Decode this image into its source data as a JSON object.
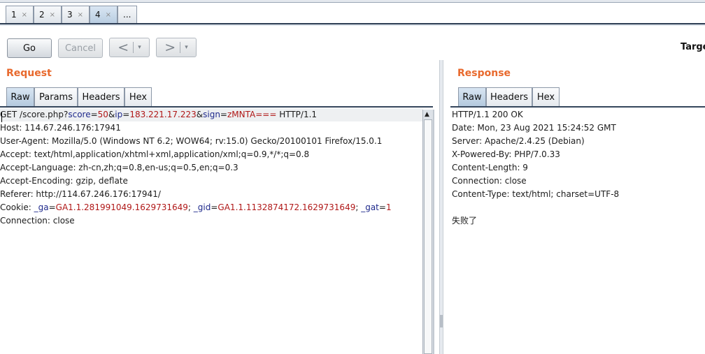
{
  "tabs": [
    {
      "label": "1",
      "close": "×"
    },
    {
      "label": "2",
      "close": "×"
    },
    {
      "label": "3",
      "close": "×"
    },
    {
      "label": "4",
      "close": "×"
    },
    {
      "label": "..."
    }
  ],
  "toolbar": {
    "go": "Go",
    "cancel": "Cancel",
    "back_arrow": "<",
    "forward_arrow": ">",
    "dropdown": "▾",
    "target": "Targe"
  },
  "request": {
    "title": "Request",
    "tabs": [
      "Raw",
      "Params",
      "Headers",
      "Hex"
    ],
    "line1": {
      "p1": "GET /score.php?",
      "k1": "score",
      "eq1": "=",
      "v1": "50",
      "amp1": "&",
      "k2": "ip",
      "eq2": "=",
      "v2": "183.221.17.223",
      "amp2": "&",
      "k3": "sign",
      "eq3": "=",
      "v3": "zMNTA===",
      "p2": " HTTP/1.1"
    },
    "lines": [
      "Host: 114.67.246.176:17941",
      "User-Agent: Mozilla/5.0 (Windows NT 6.2; WOW64; rv:15.0) Gecko/20100101 Firefox/15.0.1",
      "Accept: text/html,application/xhtml+xml,application/xml;q=0.9,*/*;q=0.8",
      "Accept-Language: zh-cn,zh;q=0.8,en-us;q=0.5,en;q=0.3",
      "Accept-Encoding: gzip, deflate",
      "Referer: http://114.67.246.176:17941/"
    ],
    "cookie": {
      "prefix": "Cookie: ",
      "k1": "_ga",
      "eq1": "=",
      "v1": "GA1.1.281991049.1629731649",
      "sep1": "; ",
      "k2": "_gid",
      "eq2": "=",
      "v2": "GA1.1.1132874172.1629731649",
      "sep2": "; ",
      "k3": "_gat",
      "eq3": "=",
      "v3": "1"
    },
    "last_line": "Connection: close",
    "scroll_up": "▲"
  },
  "response": {
    "title": "Response",
    "tabs": [
      "Raw",
      "Headers",
      "Hex"
    ],
    "lines": [
      "HTTP/1.1 200 OK",
      "Date: Mon, 23 Aug 2021 15:24:52 GMT",
      "Server: Apache/2.4.25 (Debian)",
      "X-Powered-By: PHP/7.0.33",
      "Content-Length: 9",
      "Connection: close",
      "Content-Type: text/html; charset=UTF-8",
      "",
      "失败了"
    ]
  }
}
